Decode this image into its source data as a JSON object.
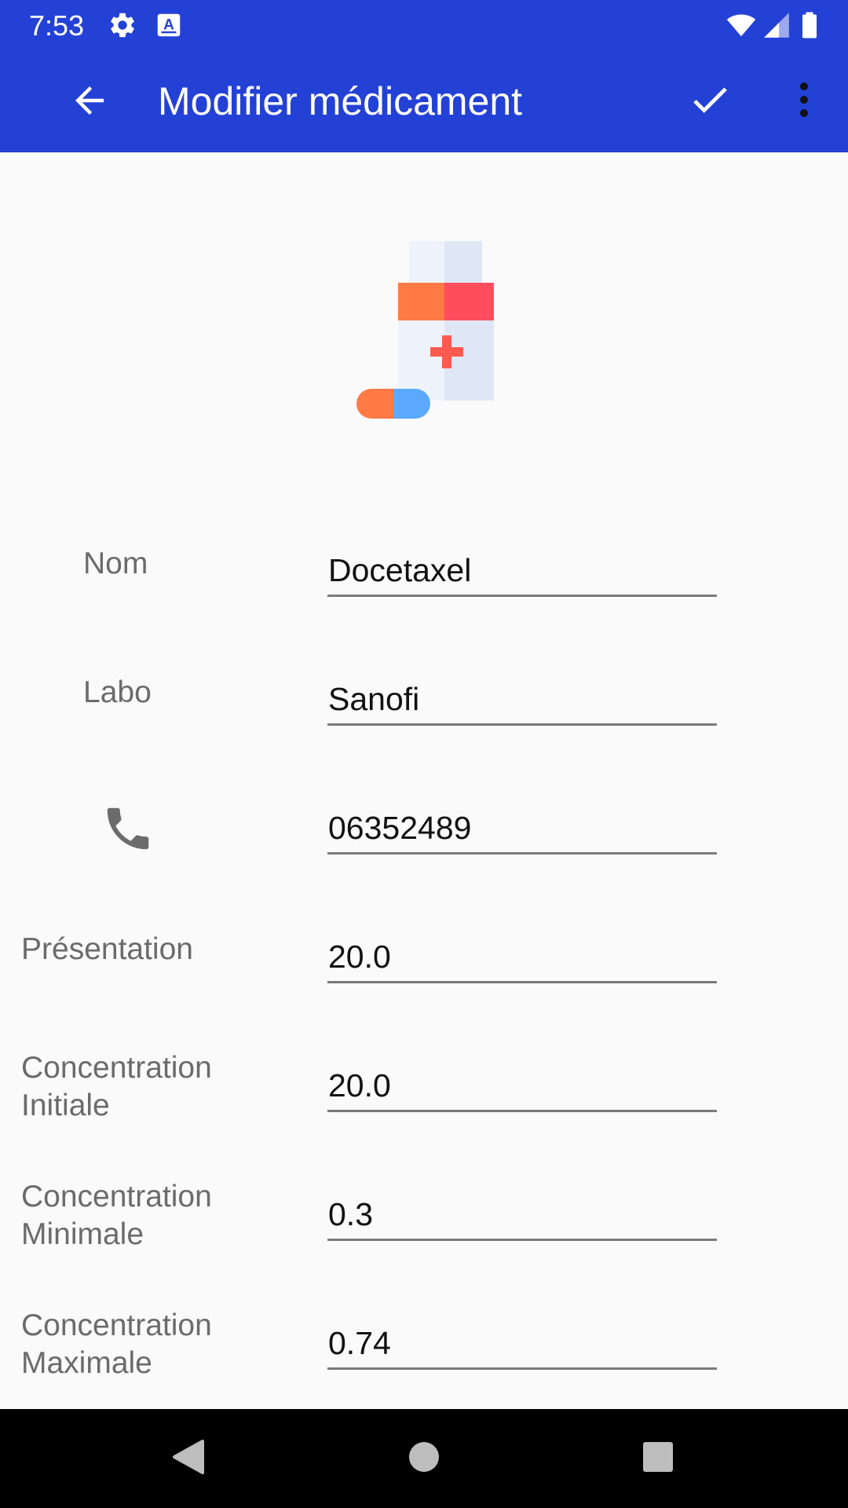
{
  "status_bar": {
    "time": "7:53",
    "icons": [
      "gear-icon",
      "a-box-icon",
      "wifi-icon",
      "signal-icon",
      "battery-icon"
    ]
  },
  "toolbar": {
    "title": "Modifier médicament",
    "back_icon": "arrow-back-icon",
    "confirm_icon": "check-icon",
    "menu_icon": "more-vert-icon"
  },
  "illustration": {
    "icon": "medicine-bottle-pill-icon"
  },
  "form": {
    "nom": {
      "label": "Nom",
      "value": "Docetaxel"
    },
    "labo": {
      "label": "Labo",
      "value": "Sanofi"
    },
    "phone": {
      "icon": "phone-icon",
      "value": "06352489"
    },
    "presentation": {
      "label": "Présentation",
      "value": "20.0"
    },
    "concentration_initiale": {
      "label_line1": "Concentration",
      "label_line2": "Initiale",
      "value": "20.0"
    },
    "concentration_minimale": {
      "label_line1": "Concentration",
      "label_line2": "Minimale",
      "value": "0.3"
    },
    "concentration_maximale": {
      "label_line1": "Concentration",
      "label_line2": "Maximale",
      "value": "0.74"
    }
  },
  "nav_bar": {
    "icons": [
      "back-triangle-icon",
      "home-circle-icon",
      "recents-square-icon"
    ]
  },
  "colors": {
    "primary": "#2441d6",
    "background": "#fafafa",
    "label": "#6b6b6b",
    "text": "#111111"
  }
}
